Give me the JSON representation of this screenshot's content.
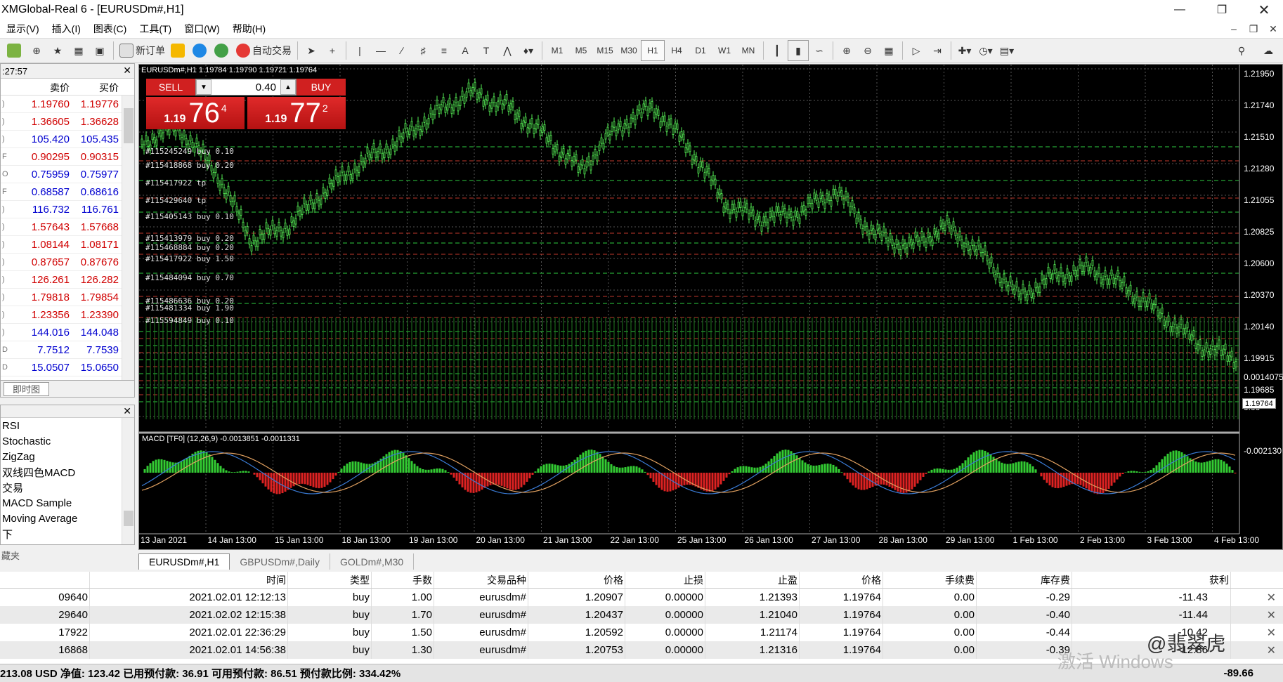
{
  "window": {
    "title": "XMGlobal-Real 6 - [EURUSDm#,H1]"
  },
  "menu": [
    "显示(V)",
    "插入(I)",
    "图表(C)",
    "工具(T)",
    "窗口(W)",
    "帮助(H)"
  ],
  "toolbar": {
    "new_order": "新订单",
    "auto_trading": "自动交易",
    "timeframes": [
      "M1",
      "M5",
      "M15",
      "M30",
      "H1",
      "H4",
      "D1",
      "W1",
      "MN"
    ],
    "active_tf": "H1"
  },
  "market_watch": {
    "time": ":27:57",
    "col_bid": "卖价",
    "col_ask": "买价",
    "rows": [
      {
        "d": ")",
        "bid": "1.19760",
        "ask": "1.19776",
        "color": "red"
      },
      {
        "d": ")",
        "bid": "1.36605",
        "ask": "1.36628",
        "color": "red"
      },
      {
        "d": ")",
        "bid": "105.420",
        "ask": "105.435",
        "color": "blue"
      },
      {
        "d": "F",
        "bid": "0.90295",
        "ask": "0.90315",
        "color": "red"
      },
      {
        "d": "O",
        "bid": "0.75959",
        "ask": "0.75977",
        "color": "blue"
      },
      {
        "d": "F",
        "bid": "0.68587",
        "ask": "0.68616",
        "color": "blue"
      },
      {
        "d": ")",
        "bid": "116.732",
        "ask": "116.761",
        "color": "blue"
      },
      {
        "d": ")",
        "bid": "1.57643",
        "ask": "1.57668",
        "color": "red"
      },
      {
        "d": ")",
        "bid": "1.08144",
        "ask": "1.08171",
        "color": "red"
      },
      {
        "d": ")",
        "bid": "0.87657",
        "ask": "0.87676",
        "color": "red"
      },
      {
        "d": ")",
        "bid": "126.261",
        "ask": "126.282",
        "color": "red"
      },
      {
        "d": ")",
        "bid": "1.79818",
        "ask": "1.79854",
        "color": "red"
      },
      {
        "d": ")",
        "bid": "1.23356",
        "ask": "1.23390",
        "color": "red"
      },
      {
        "d": ")",
        "bid": "144.016",
        "ask": "144.048",
        "color": "blue"
      },
      {
        "d": "D",
        "bid": "7.7512",
        "ask": "7.7539",
        "color": "blue"
      },
      {
        "d": "D",
        "bid": "15.0507",
        "ask": "15.0650",
        "color": "blue"
      }
    ],
    "tab": "即时图"
  },
  "navigator": {
    "items": [
      "RSI",
      "Stochastic",
      "ZigZag",
      "双线四色MACD",
      "交易",
      "MACD Sample",
      "Moving Average",
      "下"
    ],
    "tab": "藏夹"
  },
  "chart": {
    "header": "EURUSDm#,H1  1.19784 1.19790 1.19721 1.19764",
    "macd_header": "MACD [TF0] (12,26,9) -0.0013851 -0.0011331",
    "sell_label": "SELL",
    "buy_label": "BUY",
    "volume": "0.40",
    "sell_price": {
      "small": "1.19",
      "large": "76",
      "sup": "4"
    },
    "buy_price": {
      "small": "1.19",
      "large": "77",
      "sup": "2"
    },
    "current_price": "1.19764",
    "price_axis": [
      "1.21950",
      "1.21740",
      "1.21510",
      "1.21280",
      "1.21055",
      "1.20825",
      "1.20600",
      "1.20370",
      "1.20140",
      "1.19915",
      "1.19685"
    ],
    "macd_axis": [
      "0.0014075",
      "0.00",
      "-0.002130"
    ],
    "time_axis": [
      "13 Jan 2021",
      "14 Jan 13:00",
      "15 Jan 13:00",
      "18 Jan 13:00",
      "19 Jan 13:00",
      "20 Jan 13:00",
      "21 Jan 13:00",
      "22 Jan 13:00",
      "25 Jan 13:00",
      "26 Jan 13:00",
      "27 Jan 13:00",
      "28 Jan 13:00",
      "29 Jan 13:00",
      "1 Feb 13:00",
      "2 Feb 13:00",
      "3 Feb 13:00",
      "4 Feb 13:00"
    ],
    "order_labels": [
      "#115245249 buy 0.10",
      "#115418868 buy 0.20",
      "#115417922 tp",
      "#115429640 tp",
      "#115405143 buy 0.10",
      "#115413979 buy 0.20",
      "#115468884 buy 0.20",
      "#115417922 buy 1.50",
      "#115484094 buy 0.70",
      "#115486636 buy 0.20",
      "#115481334 buy 1.90",
      "#115594849 buy 0.10"
    ]
  },
  "chart_tabs": [
    "EURUSDm#,H1",
    "GBPUSDm#,Daily",
    "GOLDm#,M30"
  ],
  "terminal": {
    "headers": [
      "",
      "时间",
      "类型",
      "手数",
      "交易品种",
      "价格",
      "止损",
      "止盈",
      "价格",
      "手续费",
      "库存费",
      "获利"
    ],
    "rows": [
      [
        "09640",
        "2021.02.01 12:12:13",
        "buy",
        "1.00",
        "eurusdm#",
        "1.20907",
        "0.00000",
        "1.21393",
        "1.19764",
        "0.00",
        "-0.29",
        "-11.43"
      ],
      [
        "29640",
        "2021.02.02 12:15:38",
        "buy",
        "1.70",
        "eurusdm#",
        "1.20437",
        "0.00000",
        "1.21040",
        "1.19764",
        "0.00",
        "-0.40",
        "-11.44"
      ],
      [
        "17922",
        "2021.02.01 22:36:29",
        "buy",
        "1.50",
        "eurusdm#",
        "1.20592",
        "0.00000",
        "1.21174",
        "1.19764",
        "0.00",
        "-0.44",
        "-10.42"
      ],
      [
        "16868",
        "2021.02.01 14:56:38",
        "buy",
        "1.30",
        "eurusdm#",
        "1.20753",
        "0.00000",
        "1.21316",
        "1.19764",
        "0.00",
        "-0.39",
        "-12.86"
      ]
    ],
    "status": "213.08 USD  净值: 123.42  已用预付款: 36.91  可用预付款: 86.51  预付款比例: 334.42%",
    "total": "-89.66"
  },
  "watermark": {
    "activate": "激活 Windows",
    "brand": "@翡翠虎"
  }
}
